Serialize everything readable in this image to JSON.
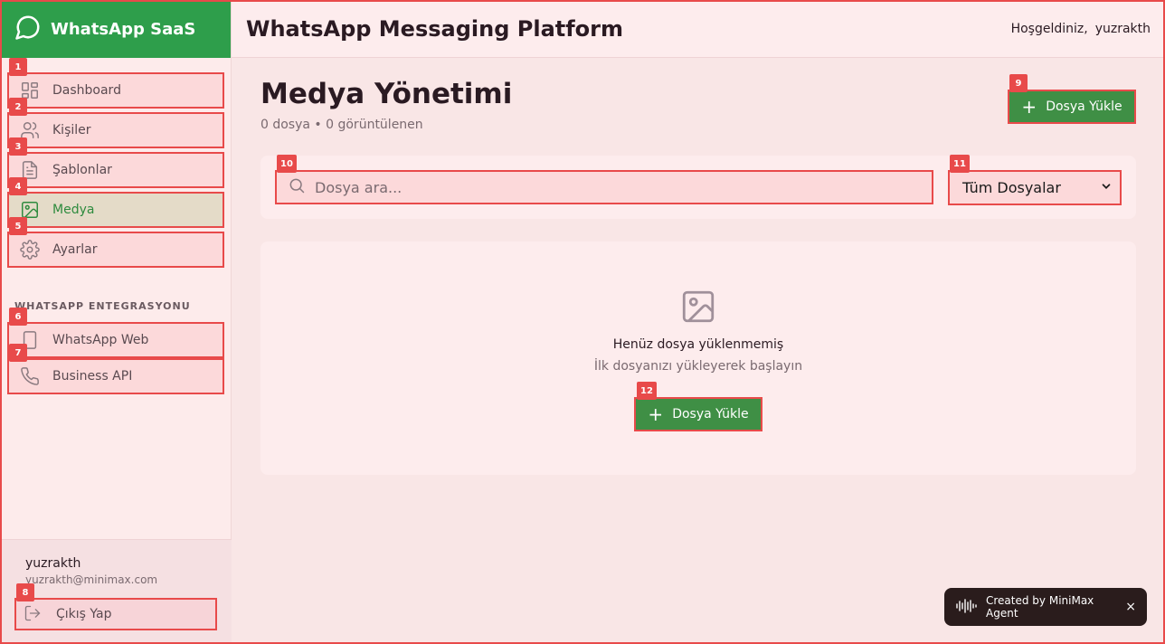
{
  "brand": {
    "name": "WhatsApp SaaS"
  },
  "header": {
    "title": "WhatsApp Messaging Platform",
    "welcome_label": "Hoşgeldiniz,",
    "username": "yuzrakth"
  },
  "sidebar": {
    "items": [
      {
        "badge": "1",
        "label": "Dashboard",
        "icon": "dashboard-icon"
      },
      {
        "badge": "2",
        "label": "Kişiler",
        "icon": "users-icon"
      },
      {
        "badge": "3",
        "label": "Şablonlar",
        "icon": "document-icon"
      },
      {
        "badge": "4",
        "label": "Medya",
        "icon": "image-icon",
        "active": true
      },
      {
        "badge": "5",
        "label": "Ayarlar",
        "icon": "gear-icon"
      }
    ],
    "section_label": "WHATSAPP ENTEGRASYONU",
    "integration_items": [
      {
        "badge": "6",
        "label": "WhatsApp Web",
        "icon": "phone-device-icon"
      },
      {
        "badge": "7",
        "label": "Business API",
        "icon": "phone-icon"
      }
    ],
    "user": {
      "name": "yuzrakth",
      "email": "yuzrakth@minimax.com"
    },
    "logout": {
      "badge": "8",
      "label": "Çıkış Yap"
    }
  },
  "main": {
    "title": "Medya Yönetimi",
    "subtitle": "0 dosya • 0 görüntülenen",
    "upload_button": {
      "badge": "9",
      "label": "Dosya Yükle"
    },
    "search": {
      "badge": "10",
      "placeholder": "Dosya ara...",
      "value": ""
    },
    "filter": {
      "badge": "11",
      "selected": "Tüm Dosyalar"
    },
    "empty": {
      "title": "Henüz dosya yüklenmemiş",
      "subtitle": "İlk dosyanızı yükleyerek başlayın",
      "button": {
        "badge": "12",
        "label": "Dosya Yükle"
      }
    }
  },
  "toast": {
    "label": "Created by MiniMax Agent",
    "close": "×"
  },
  "colors": {
    "brand_green": "#2e9e4b",
    "button_green": "#3f8f45",
    "highlight_red": "#e84a4a"
  }
}
